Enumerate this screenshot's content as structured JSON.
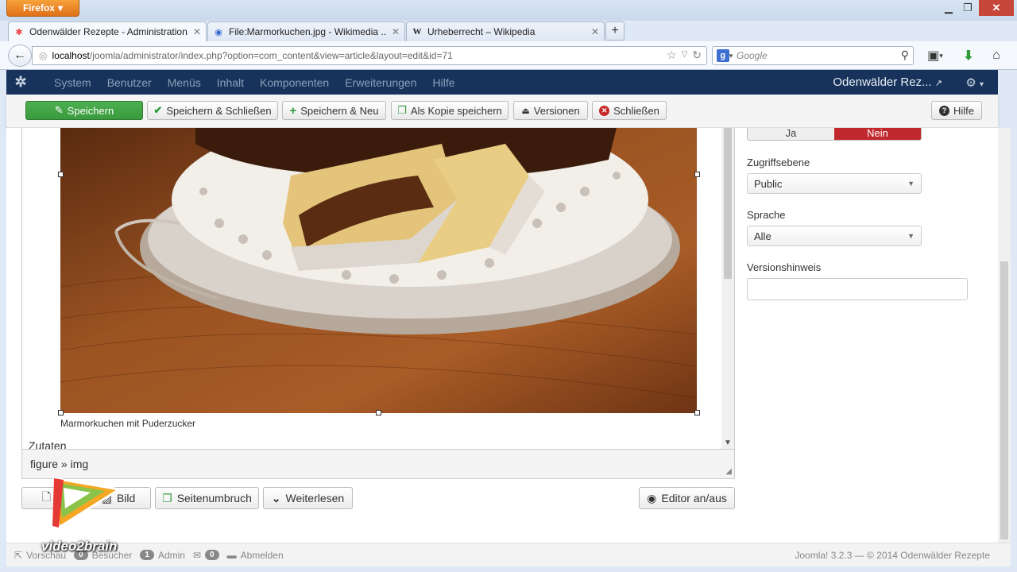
{
  "browser": {
    "app_button": "Firefox",
    "tabs": [
      {
        "title": "Odenwälder Rezepte - Administration...",
        "active": true
      },
      {
        "title": "File:Marmorkuchen.jpg - Wikimedia ...",
        "active": false
      },
      {
        "title": "Urheberrecht – Wikipedia",
        "active": false
      }
    ],
    "url_host": "localhost",
    "url_rest": "/joomla/administrator/index.php?option=com_content&view=article&layout=edit&id=71",
    "search_placeholder": "Google"
  },
  "joomla": {
    "menu": [
      "System",
      "Benutzer",
      "Menüs",
      "Inhalt",
      "Komponenten",
      "Erweiterungen",
      "Hilfe"
    ],
    "site_name": "Odenwälder Rez...",
    "toolbar": {
      "save": "Speichern",
      "save_close": "Speichern & Schließen",
      "save_new": "Speichern & Neu",
      "save_copy": "Als Kopie speichern",
      "versions": "Versionen",
      "close": "Schließen",
      "help": "Hilfe"
    }
  },
  "editor": {
    "caption": "Marmorkuchen mit Puderzucker",
    "next_heading": "Zutaten",
    "path": "figure » img",
    "buttons": {
      "article": "B",
      "image": "Bild",
      "pagebreak": "Seitenumbruch",
      "readmore": "Weiterlesen",
      "toggle": "Editor an/aus"
    }
  },
  "panel": {
    "toggle_yes": "Ja",
    "toggle_no": "Nein",
    "access_label": "Zugriffsebene",
    "access_value": "Public",
    "language_label": "Sprache",
    "language_value": "Alle",
    "version_note_label": "Versionshinweis",
    "version_note_value": ""
  },
  "footer": {
    "preview": "Vorschau",
    "visitors_count": "0",
    "visitors": "Besucher",
    "admin_count": "1",
    "admin": "Admin",
    "messages_count": "0",
    "logout": "Abmelden",
    "copyright": "Joomla! 3.2.3  —  © 2014 Odenwälder Rezepte"
  },
  "watermark": "video2brain",
  "colors": {
    "joomla_nav": "#17335c",
    "save_green": "#43a047",
    "no_red": "#c0282d"
  }
}
